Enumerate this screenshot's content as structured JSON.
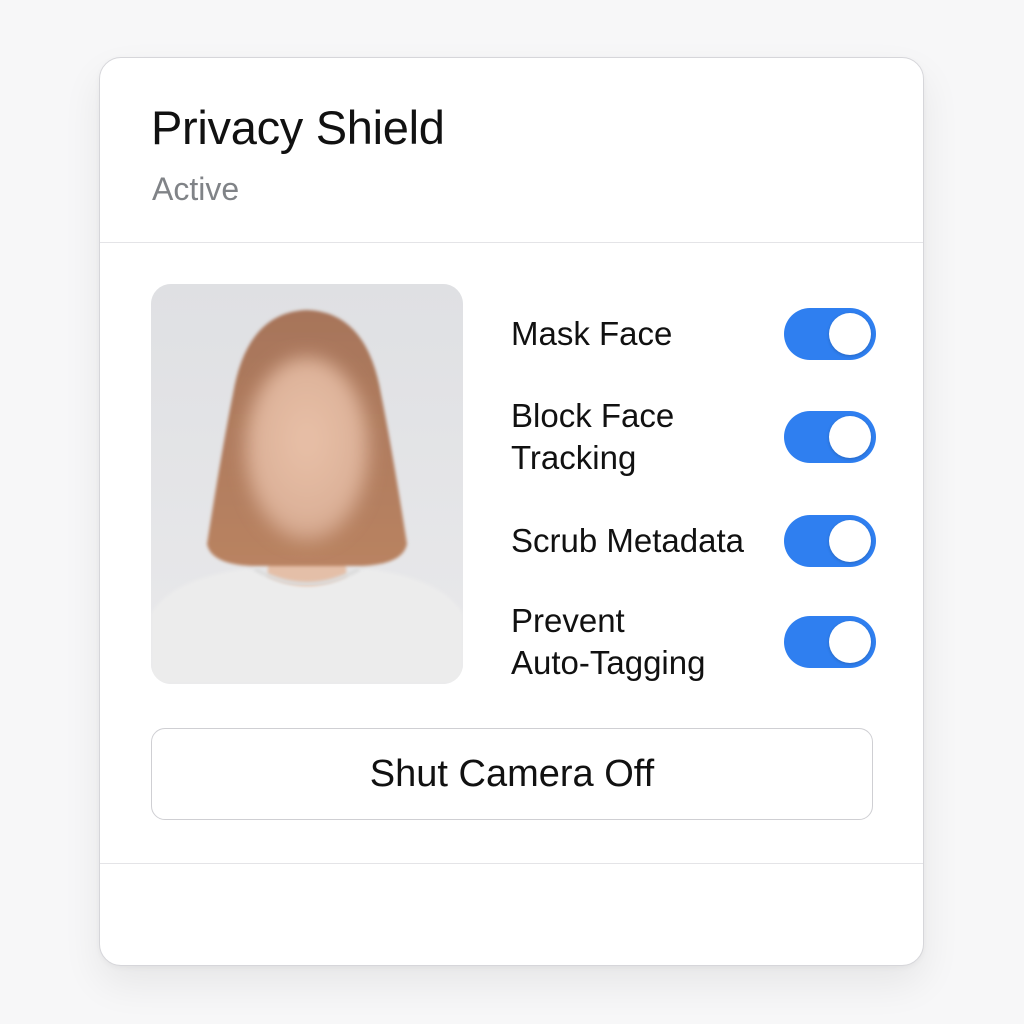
{
  "panel": {
    "title": "Privacy Shield",
    "status": "Active"
  },
  "preview": {
    "description_icon": "blurred-portrait-image"
  },
  "toggles": [
    {
      "label_line1": "Mask Face",
      "label_line2": "",
      "enabled": true
    },
    {
      "label_line1": "Block Face",
      "label_line2": "Tracking",
      "enabled": true
    },
    {
      "label_line1": "Scrub Metadata",
      "label_line2": "",
      "enabled": true
    },
    {
      "label_line1": "Prevent",
      "label_line2": "Auto-Tagging",
      "enabled": true
    }
  ],
  "actions": {
    "shut_camera_label": "Shut Camera Off"
  },
  "colors": {
    "accent": "#2f7ff0",
    "status_text": "#808387"
  }
}
